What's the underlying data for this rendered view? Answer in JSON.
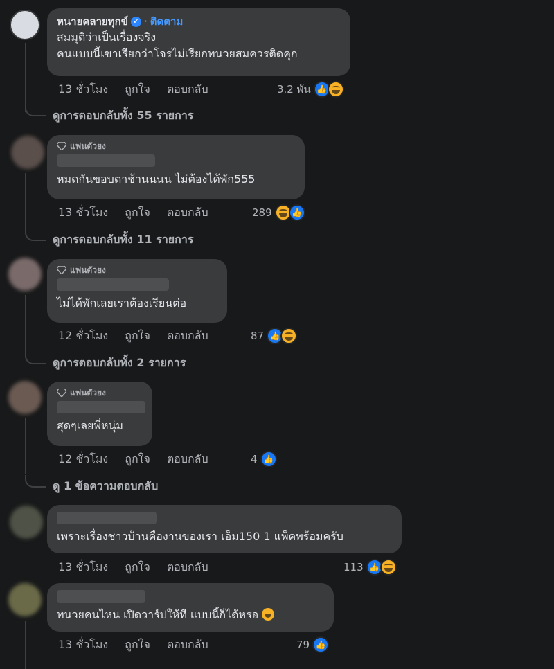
{
  "comments": [
    {
      "name": "หนายคลายทุกข์",
      "follow": "ติดตาม",
      "lines": [
        "สมมุติว่าเป็นเรื่องจริง",
        "คนแบบนี้เขาเรียกว่าโจรไม่เรียกทนวยสมควรติดคุก"
      ],
      "time": "13 ชั่วโมง",
      "like_label": "ถูกใจ",
      "reply_label": "ตอบกลับ",
      "reaction_count": "3.2 พัน",
      "reactions": [
        "like-icon",
        "haha-icon"
      ],
      "view_replies": "ดูการตอบกลับทั้ง 55 รายการ"
    },
    {
      "badge": "แฟนตัวยง",
      "lines": [
        "หมดกันขอบตาช้านนนน ไม่ต้องได้พัก555"
      ],
      "time": "13 ชั่วโมง",
      "like_label": "ถูกใจ",
      "reply_label": "ตอบกลับ",
      "reaction_count": "289",
      "reactions": [
        "haha-icon",
        "like-icon"
      ],
      "view_replies": "ดูการตอบกลับทั้ง 11 รายการ"
    },
    {
      "badge": "แฟนตัวยง",
      "lines": [
        "ไม่ได้พักเลยเราต้องเรียนต่อ"
      ],
      "time": "12 ชั่วโมง",
      "like_label": "ถูกใจ",
      "reply_label": "ตอบกลับ",
      "reaction_count": "87",
      "reactions": [
        "like-icon",
        "haha-icon"
      ],
      "view_replies": "ดูการตอบกลับทั้ง 2 รายการ"
    },
    {
      "badge": "แฟนตัวยง",
      "lines": [
        "สุดๆเลยพี่หนุ่ม"
      ],
      "time": "12 ชั่วโมง",
      "like_label": "ถูกใจ",
      "reply_label": "ตอบกลับ",
      "reaction_count": "4",
      "reactions": [
        "like-icon"
      ],
      "view_replies": "ดู 1 ข้อความตอบกลับ"
    },
    {
      "lines": [
        "เพราะเรื่องชาวบ้านคืองานของเรา เอ็ม150 1 แพ็คพร้อมครับ"
      ],
      "time": "13 ชั่วโมง",
      "like_label": "ถูกใจ",
      "reply_label": "ตอบกลับ",
      "reaction_count": "113",
      "reactions": [
        "like-icon",
        "haha-icon"
      ]
    },
    {
      "lines": [
        "ทนวยคนไหน เปิดวาร์ปให้ที แบบนี้ก็ได้หรอ"
      ],
      "emoji": "rofl-emoji",
      "time": "13 ชั่วโมง",
      "like_label": "ถูกใจ",
      "reply_label": "ตอบกลับ",
      "reaction_count": "79",
      "reactions": [
        "like-icon"
      ]
    }
  ],
  "colors": {
    "background": "#18191a",
    "bubble": "#3a3b3c",
    "link": "#4599ff",
    "like": "#1877f2",
    "haha": "#f7b125"
  }
}
